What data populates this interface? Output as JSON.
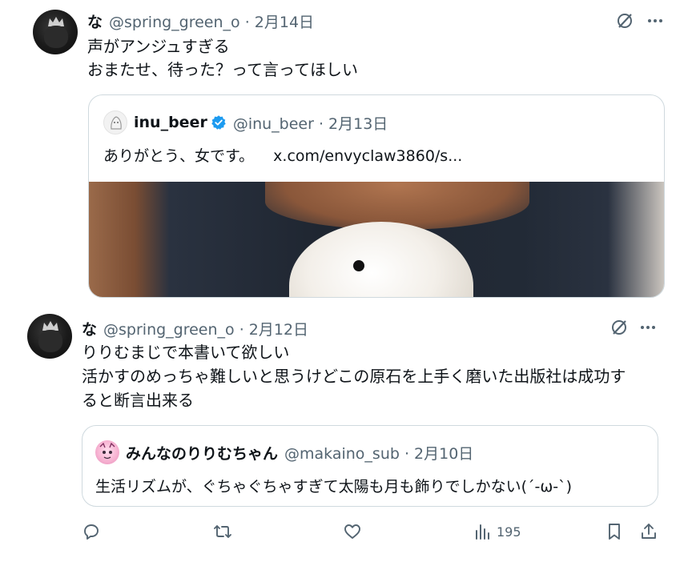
{
  "tweet1": {
    "name": "な",
    "meta": "@spring_green_o · 2月14日",
    "lines": [
      "声がアンジュすぎる",
      "おまたせ、待った？って言ってほしい"
    ],
    "quote": {
      "name": "inu_beer",
      "meta": "@inu_beer · 2月13日",
      "text": "ありがとう、女です。",
      "link": "x.com/envyclaw3860/s..."
    }
  },
  "tweet2": {
    "name": "な",
    "meta": "@spring_green_o · 2月12日",
    "lines": [
      "りりむまじで本書いて欲しい",
      "活かすのめっちゃ難しいと思うけどこの原石を上手く磨いた出版社は成功す",
      "ると断言出来る"
    ],
    "quote": {
      "name": "みんなのりりむちゃん",
      "meta": "@makaino_sub · 2月10日",
      "text": "生活リズムが、ぐちゃぐちゃすぎて太陽も月も飾りでしかない(´-ω-`)"
    }
  },
  "actions": {
    "views": "195"
  },
  "icons": [
    "grok-icon",
    "more-icon",
    "verified-icon",
    "reply-icon",
    "retweet-icon",
    "like-icon",
    "views-icon",
    "bookmark-icon",
    "share-icon"
  ],
  "colors": {
    "text": "#0f1419",
    "secondary": "#536471",
    "border": "#cfd9de",
    "verified": "#1d9bf0"
  }
}
